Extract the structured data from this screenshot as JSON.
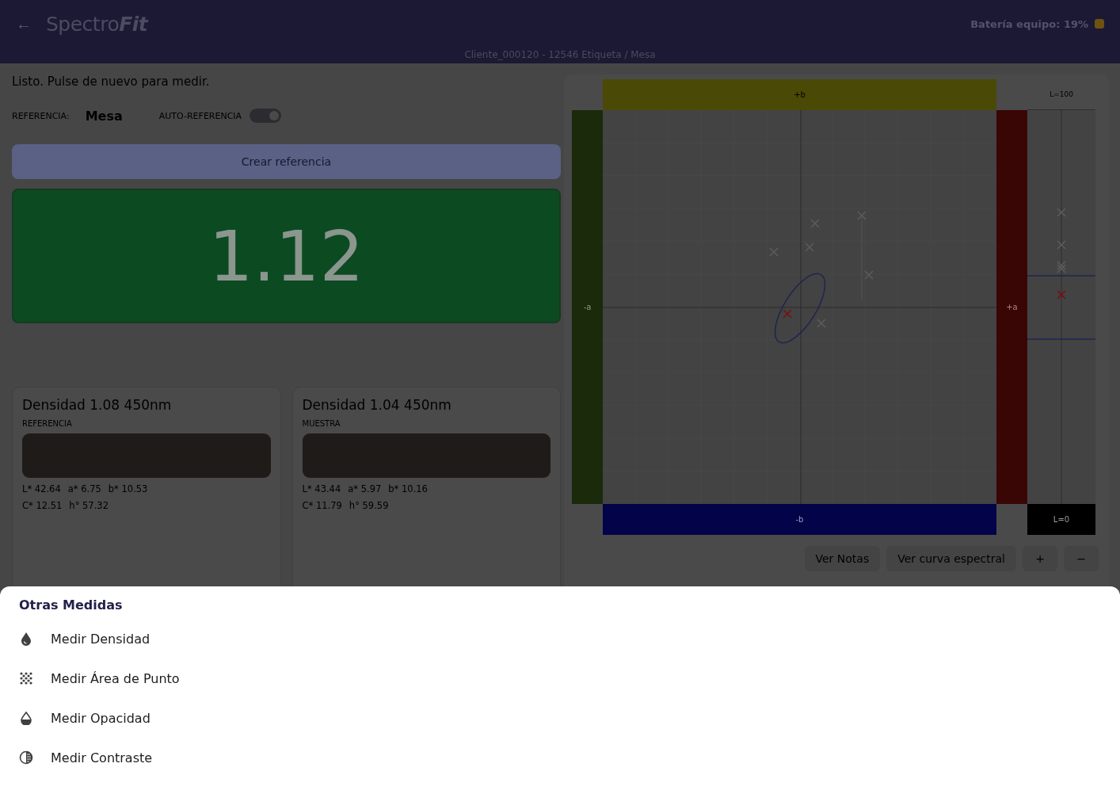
{
  "header": {
    "back": "←",
    "logo_light": "Spectro",
    "logo_bold": "Fit",
    "battery": "Batería equipo: 19%",
    "subtitle": "Cliente_000120 - 12546 Etiqueta / Mesa"
  },
  "status": "Listo. Pulse de nuevo para medir.",
  "reference": {
    "label": "REFERENCIA:",
    "value": "Mesa",
    "auto_label": "AUTO-REFERENCIA",
    "auto_on": true
  },
  "create_button": "Crear referencia",
  "result": "1.12",
  "cards": [
    {
      "title": "Densidad 1.08 450nm",
      "label": "REFERENCIA",
      "lines": [
        [
          "L* 42.64",
          "a* 6.75",
          "b* 10.53"
        ],
        [
          "C* 12.51",
          "h° 57.32"
        ]
      ]
    },
    {
      "title": "Densidad 1.04 450nm",
      "label": "MUESTRA",
      "lines": [
        [
          "L* 43.44",
          "a* 5.97",
          "b* 10.16"
        ],
        [
          "C* 11.79",
          "h° 59.59"
        ]
      ]
    }
  ],
  "chart": {
    "top": "+b",
    "left": "-a",
    "right": "+a",
    "bottom": "-b",
    "l_top": "L=100",
    "l_bottom": "L=0"
  },
  "chart_buttons": [
    "Ver Notas",
    "Ver curva espectral",
    "+",
    "−"
  ],
  "sheet": {
    "title": "Otras Medidas",
    "items": [
      {
        "kind": "density",
        "label": "Medir Densidad"
      },
      {
        "kind": "dot_area",
        "label": "Medir Área de Punto"
      },
      {
        "kind": "opacity",
        "label": "Medir Opacidad"
      },
      {
        "kind": "contrast",
        "label": "Medir Contraste"
      }
    ]
  }
}
